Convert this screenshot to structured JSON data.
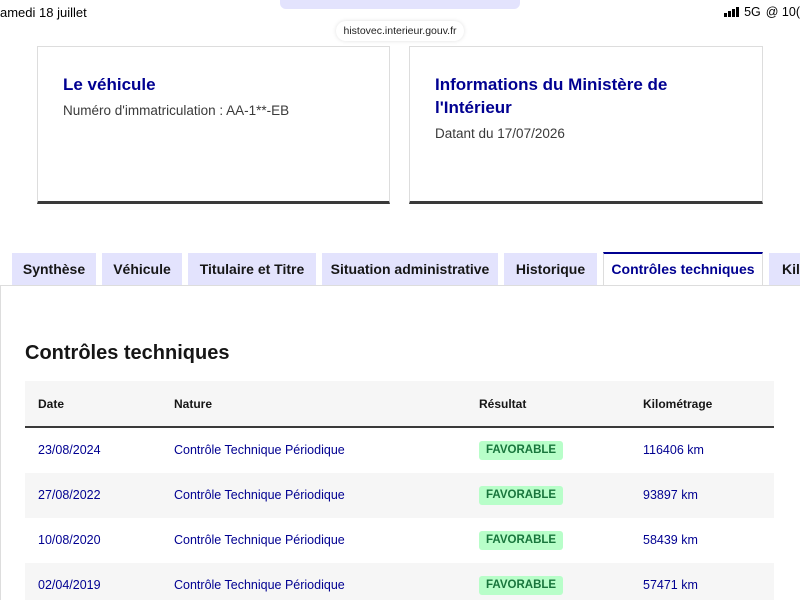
{
  "status_bar": {
    "time": "amedi 18 juillet",
    "url": "histovec.interieur.gouv.fr",
    "network": "5G",
    "extra": "@ 10("
  },
  "card_vehicle": {
    "title": "Le véhicule",
    "plate_label": "Numéro d'immatriculation : AA-1**-EB"
  },
  "card_info": {
    "title": "Informations du Ministère de l'Intérieur",
    "date_label": "Datant du 17/07/2026"
  },
  "tabs": [
    {
      "label": "Synthèse",
      "active": false
    },
    {
      "label": "Véhicule",
      "active": false
    },
    {
      "label": "Titulaire et Titre",
      "active": false
    },
    {
      "label": "Situation administrative",
      "active": false
    },
    {
      "label": "Historique",
      "active": false
    },
    {
      "label": "Contrôles techniques",
      "active": true
    },
    {
      "label": "Kilo",
      "active": false
    }
  ],
  "section": {
    "title": "Contrôles techniques"
  },
  "table": {
    "headers": [
      "Date",
      "Nature",
      "Résultat",
      "Kilométrage"
    ],
    "rows": [
      {
        "date": "23/08/2024",
        "nature": "Contrôle Technique Périodique",
        "result": "FAVORABLE",
        "km": "116406 km"
      },
      {
        "date": "27/08/2022",
        "nature": "Contrôle Technique Périodique",
        "result": "FAVORABLE",
        "km": "93897 km"
      },
      {
        "date": "10/08/2020",
        "nature": "Contrôle Technique Périodique",
        "result": "FAVORABLE",
        "km": "58439 km"
      },
      {
        "date": "02/04/2019",
        "nature": "Contrôle Technique Périodique",
        "result": "FAVORABLE",
        "km": "57471 km"
      }
    ]
  },
  "colors": {
    "accent": "#000091",
    "tab_bg": "#e3e3fd",
    "success_bg": "#b8fec9",
    "success_text": "#18753c"
  }
}
